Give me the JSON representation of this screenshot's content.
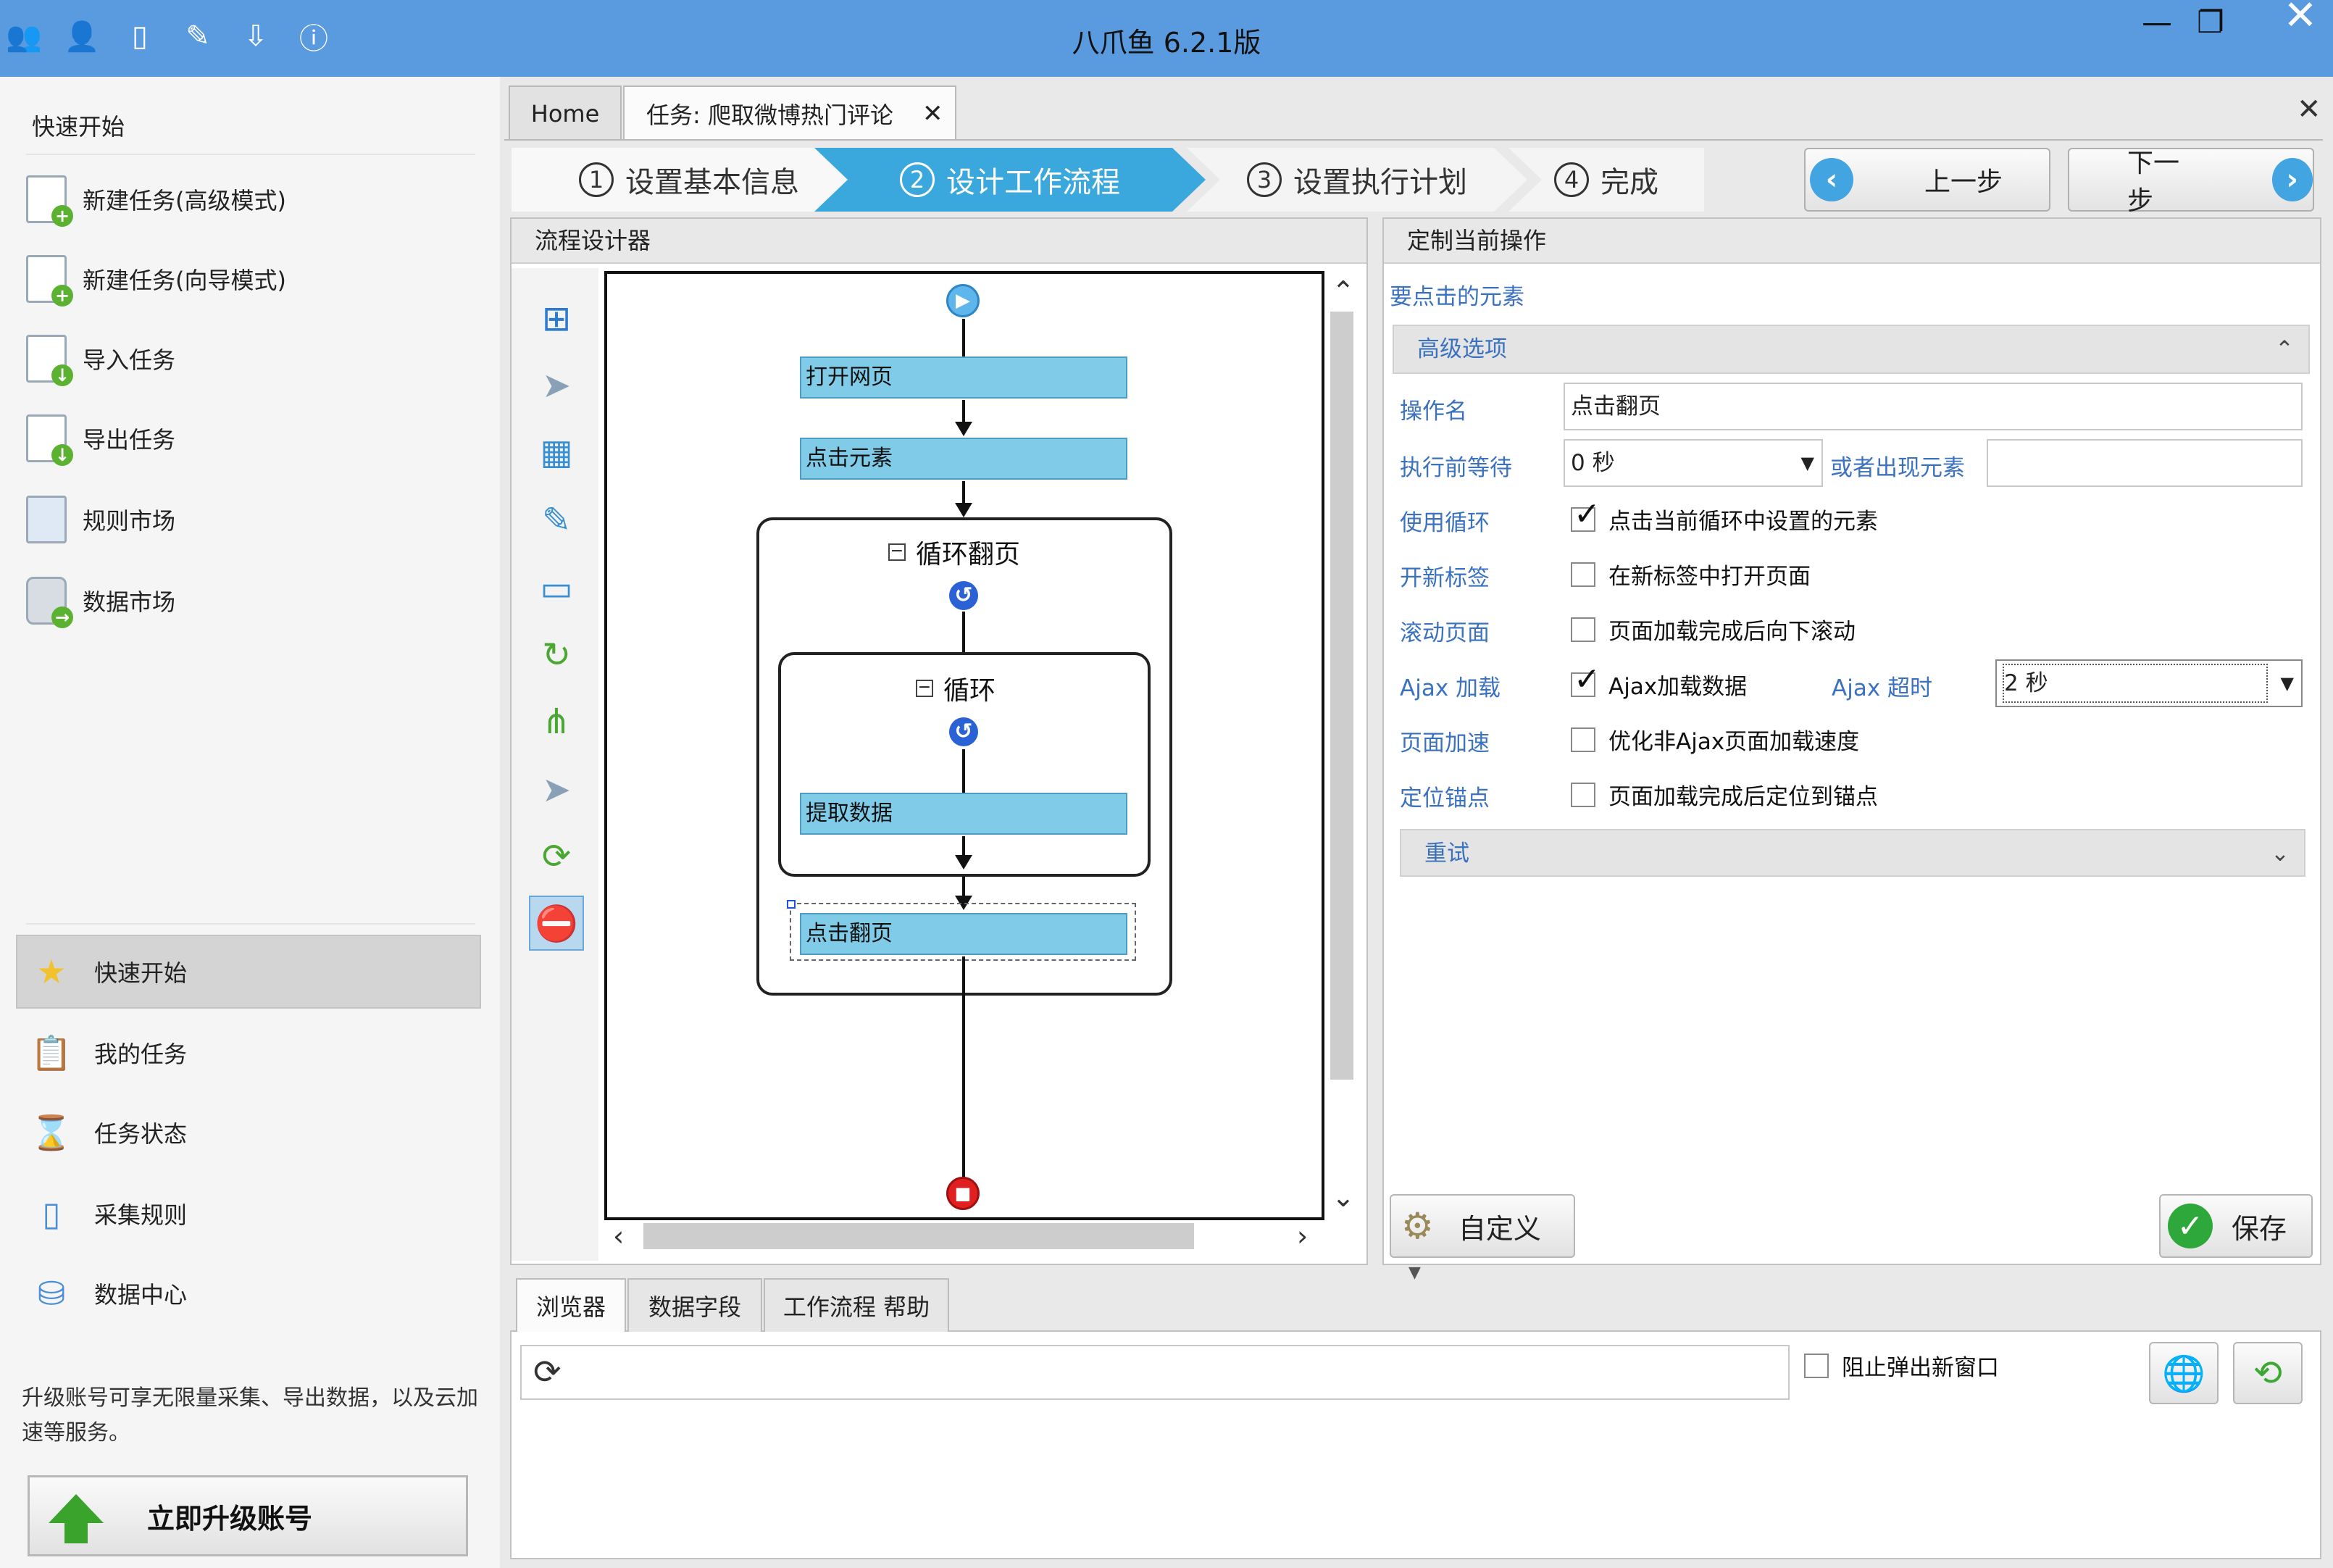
{
  "window": {
    "title": "八爪鱼 6.2.1版",
    "minimize": "—",
    "restore": "❐",
    "close": "✕",
    "toolbar_icons": [
      "user-group-icon",
      "account-icon",
      "notebook-icon",
      "pencil-icon",
      "download-icon",
      "help-icon"
    ]
  },
  "sidebar": {
    "header": "快速开始",
    "items": [
      {
        "label": "新建任务(高级模式)",
        "icon": "new-task-advanced-icon"
      },
      {
        "label": "新建任务(向导模式)",
        "icon": "new-task-wizard-icon"
      },
      {
        "label": "导入任务",
        "icon": "import-task-icon"
      },
      {
        "label": "导出任务",
        "icon": "export-task-icon"
      },
      {
        "label": "规则市场",
        "icon": "rule-market-icon"
      },
      {
        "label": "数据市场",
        "icon": "data-market-icon"
      }
    ],
    "nav": [
      {
        "label": "快速开始",
        "icon": "star-icon",
        "active": true
      },
      {
        "label": "我的任务",
        "icon": "clipboard-icon"
      },
      {
        "label": "任务状态",
        "icon": "hourglass-icon"
      },
      {
        "label": "采集规则",
        "icon": "document-icon"
      },
      {
        "label": "数据中心",
        "icon": "database-icon"
      }
    ],
    "upgrade_note": "升级账号可享无限量采集、导出数据，以及云加速等服务。",
    "upgrade_button": "立即升级账号"
  },
  "tabs": [
    {
      "label": "Home"
    },
    {
      "label": "任务: 爬取微博热门评论",
      "active": true,
      "close": "✕"
    }
  ],
  "panel_close": "✕",
  "wizard": {
    "steps": [
      {
        "num": "1",
        "label": "设置基本信息"
      },
      {
        "num": "2",
        "label": "设计工作流程",
        "active": true
      },
      {
        "num": "3",
        "label": "设置执行计划"
      },
      {
        "num": "4",
        "label": "完成"
      }
    ],
    "prev": "上一步",
    "next": "下一步"
  },
  "designer": {
    "title": "流程设计器",
    "tools": [
      "open-page-tool-icon",
      "click-element-tool-icon",
      "extract-data-tool-icon",
      "input-text-tool-icon",
      "select-option-tool-icon",
      "loop-tool-icon",
      "branch-tool-icon",
      "mouse-hover-tool-icon",
      "switch-loop-tool-icon",
      "stop-tool-icon"
    ],
    "nodes": {
      "open_page": "打开网页",
      "click_element": "点击元素",
      "loop_page": "循环翻页",
      "loop": "循环",
      "extract": "提取数据",
      "click_next": "点击翻页"
    }
  },
  "settings": {
    "title": "定制当前操作",
    "link": "要点击的元素",
    "advanced": "高级选项",
    "op_name_label": "操作名",
    "op_name_value": "点击翻页",
    "wait_label": "执行前等待",
    "wait_value": "0 秒",
    "or_label": "或者出现元素",
    "or_value": "",
    "rows": [
      {
        "label": "使用循环",
        "text": "点击当前循环中设置的元素",
        "checked": true
      },
      {
        "label": "开新标签",
        "text": "在新标签中打开页面",
        "checked": false
      },
      {
        "label": "滚动页面",
        "text": "页面加载完成后向下滚动",
        "checked": false
      },
      {
        "label": "Ajax 加载",
        "text": "Ajax加载数据",
        "checked": true
      },
      {
        "label": "页面加速",
        "text": "优化非Ajax页面加载速度",
        "checked": false
      },
      {
        "label": "定位锚点",
        "text": "页面加载完成后定位到锚点",
        "checked": false
      }
    ],
    "ajax_timeout_label": "Ajax 超时",
    "ajax_timeout_value": "2 秒",
    "retry": "重试",
    "custom_button": "自定义",
    "save_button": "保存"
  },
  "bottom": {
    "tabs": [
      {
        "label": "浏览器",
        "active": true
      },
      {
        "label": "数据字段"
      },
      {
        "label": "工作流程 帮助"
      }
    ],
    "url_value": "",
    "block_popup": "阻止弹出新窗口"
  },
  "colors": {
    "titlebar": "#5a9be0",
    "step_active": "#3aa8dd",
    "node_fill": "#7fcbe8",
    "label_blue": "#3b72c0"
  }
}
